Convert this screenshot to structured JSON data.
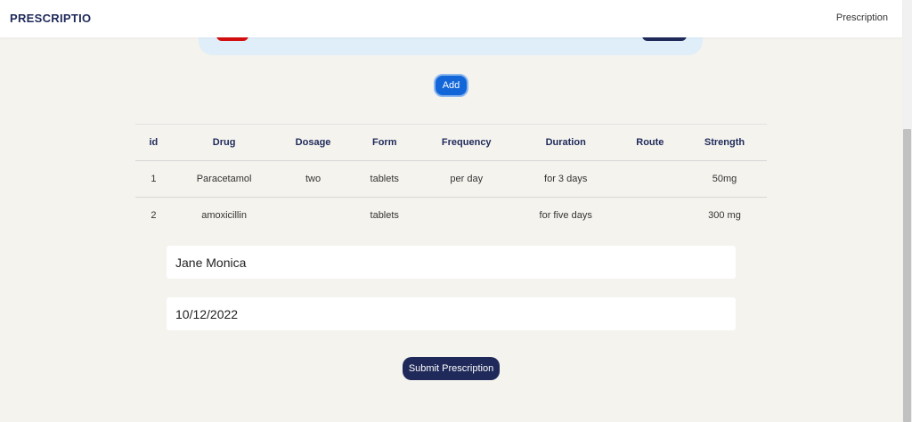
{
  "navbar": {
    "brand": "PRESCRIPTIO",
    "link": "Prescription"
  },
  "actions": {
    "add_label": "Add",
    "submit_label": "Submit Prescription"
  },
  "table": {
    "headers": [
      "id",
      "Drug",
      "Dosage",
      "Form",
      "Frequency",
      "Duration",
      "Route",
      "Strength"
    ],
    "rows": [
      [
        "1",
        "Paracetamol",
        "two",
        "tablets",
        "per day",
        "for 3 days",
        "",
        "50mg"
      ],
      [
        "2",
        "amoxicillin",
        "",
        "tablets",
        "",
        "for five days",
        "",
        "300 mg"
      ]
    ]
  },
  "fields": {
    "patient_name": "Jane Monica",
    "date": "10/12/2022"
  },
  "colors": {
    "brand_navy": "#1f2a5a",
    "primary_blue": "#1266d8",
    "danger_red": "#d40f0f",
    "page_bg": "#f4f3ee",
    "card_bg": "#dfeef8"
  }
}
